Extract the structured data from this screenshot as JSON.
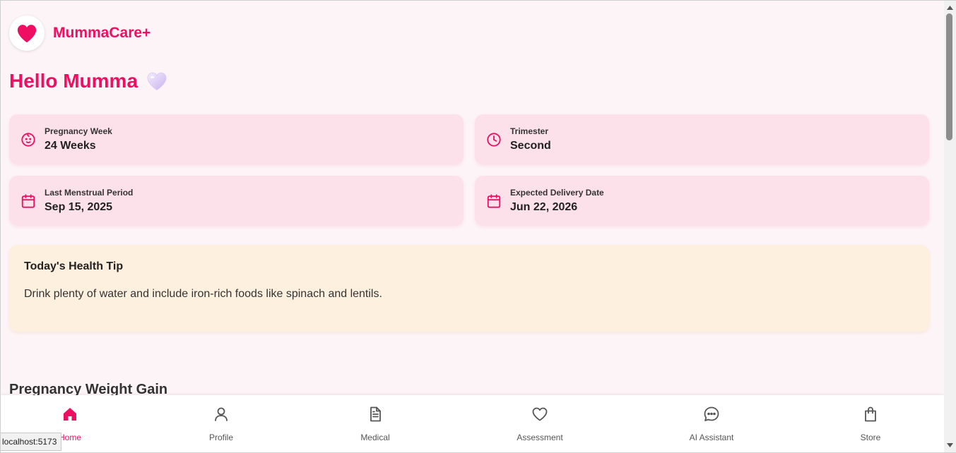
{
  "header": {
    "brand_name": "MummaCare+",
    "logo_icon": "heart-icon"
  },
  "greeting": {
    "text": "Hello Mumma",
    "emoji_icon": "purple-heart-icon"
  },
  "stats": [
    {
      "label": "Pregnancy Week",
      "value": "24 Weeks",
      "icon": "baby-face-icon"
    },
    {
      "label": "Trimester",
      "value": "Second",
      "icon": "clock-icon"
    },
    {
      "label": "Last Menstrual Period",
      "value": "Sep 15, 2025",
      "icon": "calendar-icon"
    },
    {
      "label": "Expected Delivery Date",
      "value": "Jun 22, 2026",
      "icon": "calendar-icon"
    }
  ],
  "health_tip": {
    "title": "Today's Health Tip",
    "body": "Drink plenty of water and include iron-rich foods like spinach and lentils."
  },
  "weight_section": {
    "title": "Pregnancy Weight Gain"
  },
  "nav": {
    "items": [
      {
        "label": "Home",
        "icon": "home-icon",
        "active": true
      },
      {
        "label": "Profile",
        "icon": "user-icon",
        "active": false
      },
      {
        "label": "Medical",
        "icon": "document-icon",
        "active": false
      },
      {
        "label": "Assessment",
        "icon": "heart-outline-icon",
        "active": false
      },
      {
        "label": "AI Assistant",
        "icon": "chat-icon",
        "active": false
      },
      {
        "label": "Store",
        "icon": "shopping-bag-icon",
        "active": false
      }
    ]
  },
  "status_bar": {
    "url": "localhost:5173"
  },
  "colors": {
    "accent": "#ee0f62",
    "card_bg": "#fde1ea",
    "tip_bg": "#fef0df",
    "page_bg": "#fdf4f7"
  }
}
